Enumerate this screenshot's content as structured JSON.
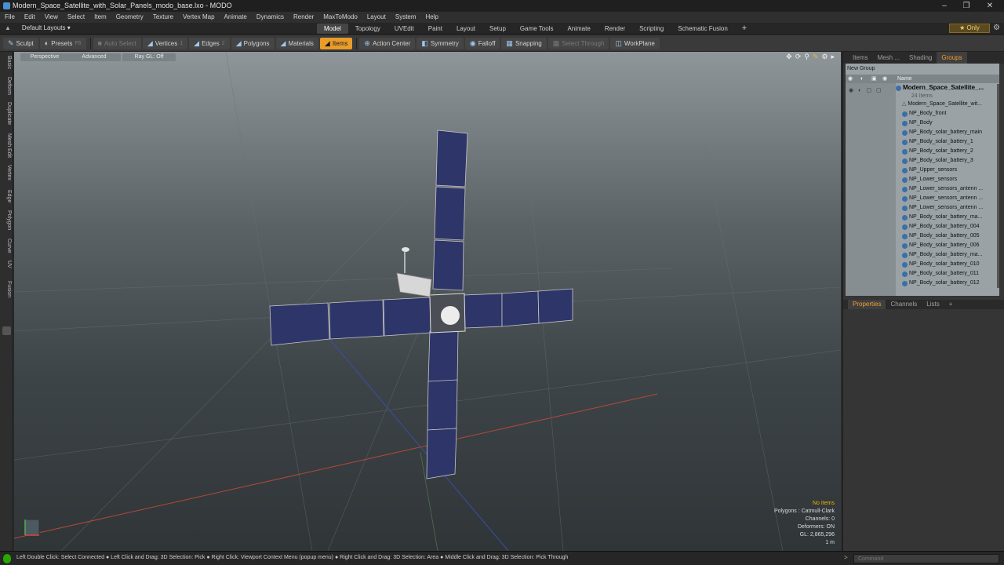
{
  "window": {
    "title": "Modern_Space_Satellite_with_Solar_Panels_modo_base.lxo - MODO"
  },
  "menu": [
    "File",
    "Edit",
    "View",
    "Select",
    "Item",
    "Geometry",
    "Texture",
    "Vertex Map",
    "Animate",
    "Dynamics",
    "Render",
    "MaxToModo",
    "Layout",
    "System",
    "Help"
  ],
  "layout": {
    "label": "Default Layouts ▾",
    "tabs": [
      "Model",
      "Topology",
      "UVEdit",
      "Paint",
      "Layout",
      "Setup",
      "Game Tools",
      "Animate",
      "Render",
      "Scripting",
      "Schematic Fusion"
    ],
    "active_tab": "Model",
    "add": "+",
    "only": "★ Only"
  },
  "toolbar": {
    "sculpt": "Sculpt",
    "presets": "Presets",
    "presets_key": "F6",
    "auto_select": "Auto Select",
    "vertices": "Vertices",
    "vertices_key": "1",
    "edges": "Edges",
    "edges_key": "2",
    "polygons": "Polygons",
    "materials": "Materials",
    "items": "Items",
    "action_center": "Action Center",
    "symmetry": "Symmetry",
    "falloff": "Falloff",
    "snapping": "Snapping",
    "select_through": "Select Through",
    "workplane": "WorkPlane"
  },
  "left_tabs": [
    "Basic",
    "Deform",
    "Duplicate",
    "Mesh Edit",
    "Vertex",
    "Edge",
    "Polygon",
    "Curve",
    "UV",
    "Fusion"
  ],
  "viewport": {
    "perspective": "Perspective",
    "advanced": "Advanced",
    "raygl": "Ray GL: Off",
    "stats": {
      "no_items": "No Items",
      "polygons": "Polygons : Catmull-Clark",
      "channels": "Channels: 0",
      "deformers": "Deformers: ON",
      "gl": "GL: 2,865,296",
      "scale": "1 m"
    }
  },
  "right_panel": {
    "tabs": [
      "Items",
      "Mesh ...",
      "Shading",
      "Groups"
    ],
    "active_tab": "Groups",
    "new_group": "New Group",
    "name_header": "Name",
    "root": "Modern_Space_Satellite_...",
    "root_sub": "24 Items",
    "items": [
      "Modern_Space_Satellite_wit...",
      "NP_Body_front",
      "NP_Body",
      "NP_Body_solar_battery_main",
      "NP_Body_solar_battery_1",
      "NP_Body_solar_battery_2",
      "NP_Body_solar_battery_3",
      "NP_Upper_sensors",
      "NP_Lower_sensors",
      "NP_Lower_sensors_antenn ...",
      "NP_Lower_sensors_antenn ...",
      "NP_Lower_sensors_antenn ...",
      "NP_Body_solar_battery_ma...",
      "NP_Body_solar_battery_004",
      "NP_Body_solar_battery_005",
      "NP_Body_solar_battery_006",
      "NP_Body_solar_battery_ma...",
      "NP_Body_solar_battery_010",
      "NP_Body_solar_battery_011",
      "NP_Body_solar_battery_012"
    ],
    "prop_tabs": [
      "Properties",
      "Channels",
      "Lists"
    ],
    "active_prop_tab": "Properties"
  },
  "statusbar": {
    "hint": "Left Double Click: Select Connected ● Left Click and Drag: 3D Selection: Pick ● Right Click: Viewport Context Menu (popup menu) ● Right Click and Drag: 3D Selection: Area ● Middle Click and Drag: 3D Selection: Pick Through",
    "command_placeholder": "Command"
  }
}
